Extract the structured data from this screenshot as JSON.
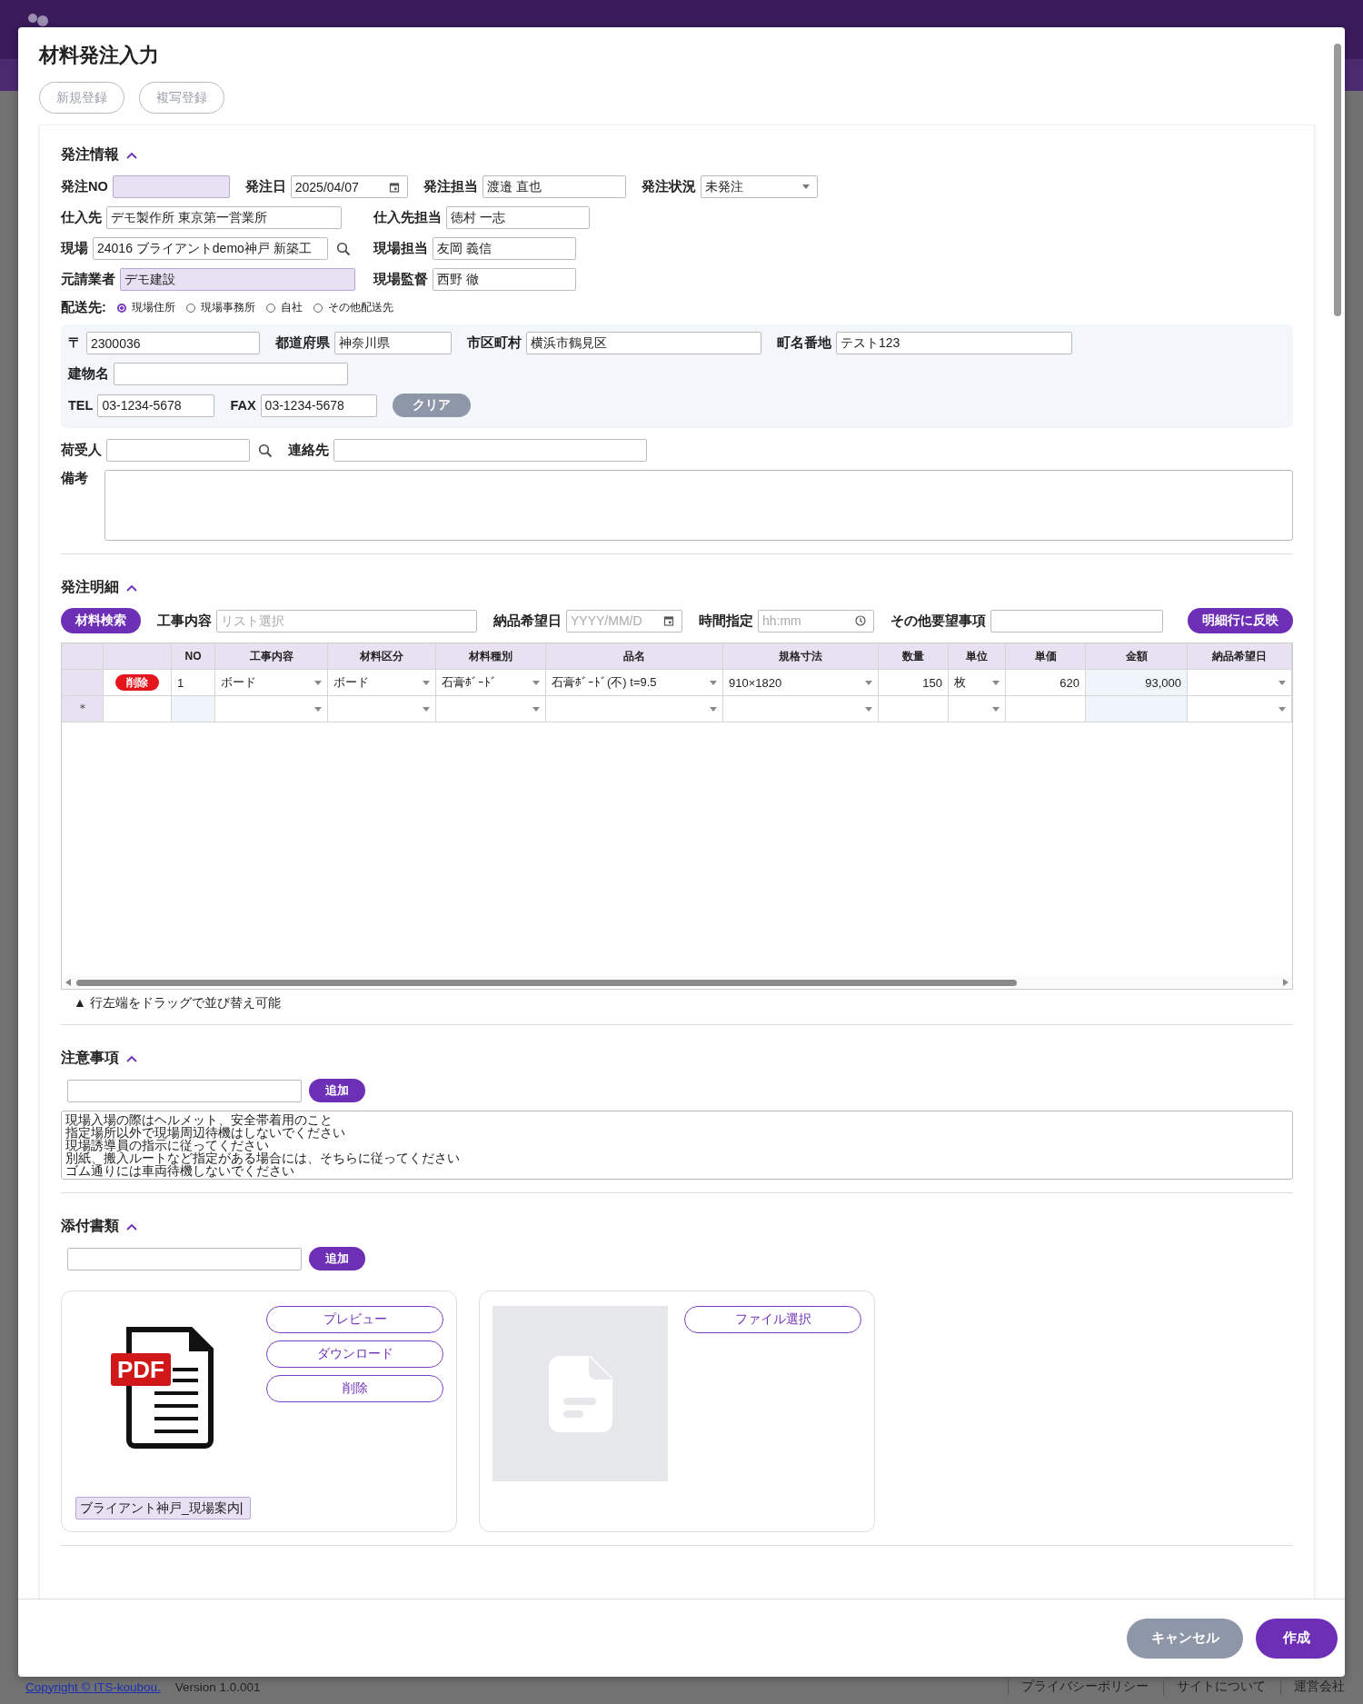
{
  "dialog": {
    "title": "材料発注入力",
    "toolbar_buttons": [
      {
        "label": "新規登録",
        "disabled": true
      },
      {
        "label": "複写登録",
        "disabled": true
      }
    ]
  },
  "order_info": {
    "title": "発注情報",
    "expanded": true,
    "rows": [
      [
        {
          "label": "発注NO",
          "kind": "text",
          "readonly": true
        },
        {
          "label": "発注日",
          "value": "2025/04/07",
          "kind": "date",
          "readonly": false
        },
        {
          "label": "発注担当",
          "value": "渡邉 直也",
          "kind": "text",
          "readonly": false
        },
        {
          "label": "発注状況",
          "value": "未発注",
          "kind": "select",
          "readonly": false
        }
      ],
      [
        {
          "label": "仕入先",
          "value": "デモ製作所 東京第一営業所",
          "kind": "text",
          "readonly": false
        },
        {
          "label": "仕入先担当",
          "value": "徳村 一志",
          "kind": "text",
          "readonly": false
        }
      ],
      [
        {
          "label": "現場",
          "value": "24016 ブライアントdemo神戸 新築工",
          "kind": "search",
          "readonly": false
        },
        {
          "label": "現場担当",
          "value": "友岡 義信",
          "kind": "text",
          "readonly": false
        }
      ],
      [
        {
          "label": "元請業者",
          "value": "デモ建設",
          "kind": "text",
          "readonly": true
        },
        {
          "label": "現場監督",
          "value": "西野 徹",
          "kind": "text",
          "readonly": false
        }
      ]
    ],
    "delivery": {
      "label": "配送先:",
      "options": [
        {
          "label": "現場住所",
          "selected": true
        },
        {
          "label": "現場事務所",
          "selected": false
        },
        {
          "label": "自社",
          "selected": false
        },
        {
          "label": "その他配送先",
          "selected": false
        }
      ]
    },
    "address_rows": [
      [
        {
          "label": "〒",
          "value": "2300036",
          "kind": "text"
        },
        {
          "label": "都道府県",
          "value": "神奈川県",
          "kind": "text"
        },
        {
          "label": "市区町村",
          "value": "横浜市鶴見区",
          "kind": "text"
        },
        {
          "label": "町名番地",
          "value": "テスト123",
          "kind": "text"
        }
      ],
      [
        {
          "label": "建物名",
          "kind": "text"
        }
      ],
      [
        {
          "label": "TEL",
          "value": "03-1234-5678",
          "kind": "text"
        },
        {
          "label": "FAX",
          "value": "03-1234-5678",
          "kind": "text"
        }
      ]
    ],
    "clear_button": "クリア",
    "contact_row": [
      {
        "label": "荷受人",
        "kind": "search"
      },
      {
        "label": "連絡先",
        "kind": "text"
      }
    ],
    "remarks_label": "備考"
  },
  "details": {
    "title": "発注明細",
    "expanded": true,
    "search_button": "材料検索",
    "fields": [
      {
        "label": "工事内容",
        "placeholder": "リスト選択",
        "kind": "text"
      },
      {
        "label": "納品希望日",
        "placeholder": "YYYY/MM/D",
        "kind": "date"
      },
      {
        "label": "時間指定",
        "placeholder": "hh:mm",
        "kind": "time"
      },
      {
        "label": "その他要望事項",
        "kind": "text"
      }
    ],
    "apply_button": "明細行に反映",
    "columns": [
      {
        "label": "NO",
        "kind": "text"
      },
      {
        "label": "工事内容",
        "kind": "select"
      },
      {
        "label": "材料区分",
        "kind": "select"
      },
      {
        "label": "材料種別",
        "kind": "select"
      },
      {
        "label": "品名",
        "kind": "select"
      },
      {
        "label": "規格寸法",
        "kind": "select"
      },
      {
        "label": "数量",
        "kind": "number"
      },
      {
        "label": "単位",
        "kind": "select"
      },
      {
        "label": "単価",
        "kind": "number"
      },
      {
        "label": "金額",
        "kind": "computed"
      },
      {
        "label": "納品希望日",
        "kind": "select"
      }
    ],
    "rows": [
      {
        "kind": "data",
        "delete_label": "削除",
        "cells": [
          "1",
          "ボード",
          "ボード",
          "石膏ﾎﾞｰﾄﾞ",
          "石膏ﾎﾞｰﾄﾞ(不) t=9.5",
          "910×1820",
          "150",
          "枚",
          "620",
          "93,000",
          ""
        ]
      },
      {
        "kind": "new",
        "marker": "＊",
        "cells": [
          "",
          "",
          "",
          "",
          "",
          "",
          "",
          "",
          "",
          "",
          ""
        ]
      }
    ],
    "hint": "▲ 行左端をドラッグで並び替え可能"
  },
  "notes": {
    "title": "注意事項",
    "expanded": true,
    "add_button": "追加",
    "lines": [
      "現場入場の際はヘルメット、安全帯着用のこと",
      "指定場所以外で現場周辺待機はしないでください",
      "現場誘導員の指示に従ってください",
      "別紙、搬入ルートなど指定がある場合には、そちらに従ってください",
      "ゴム通りには車両待機しないでください"
    ]
  },
  "attachments": {
    "title": "添付書類",
    "expanded": true,
    "add_button": "追加",
    "cards": [
      {
        "kind": "file",
        "badge": "PDF",
        "file_name": "ブライアント神戸_現場案内|",
        "buttons": [
          "プレビュー",
          "ダウンロード",
          "削除"
        ]
      },
      {
        "kind": "empty",
        "buttons": [
          "ファイル選択"
        ]
      }
    ]
  },
  "footer_buttons": [
    {
      "label": "キャンセル",
      "kind": "secondary"
    },
    {
      "label": "作成",
      "kind": "primary"
    }
  ],
  "page_footer": {
    "copyright": "Copyright © ITS-koubou.",
    "version": "Version 1.0.001",
    "links": [
      "プライバシーポリシー",
      "サイトについて",
      "運営会社"
    ]
  }
}
